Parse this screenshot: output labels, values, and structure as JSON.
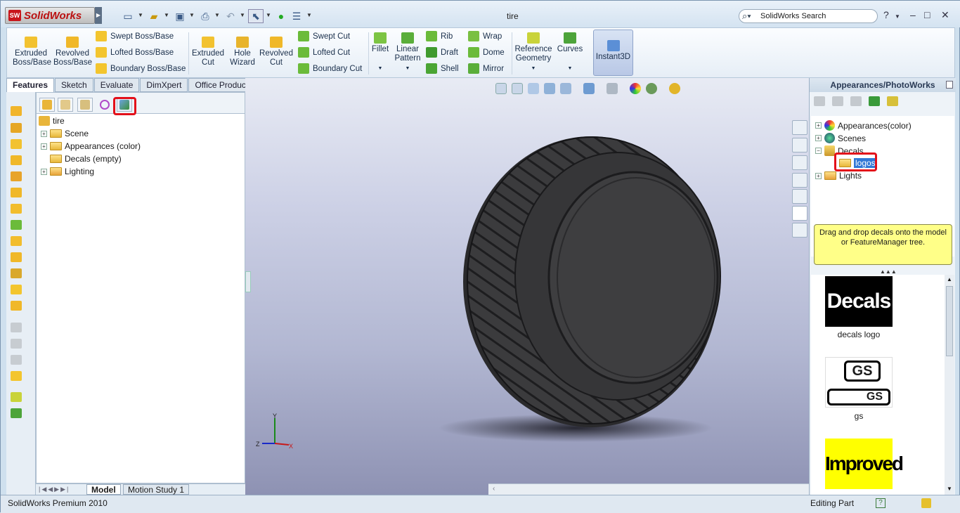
{
  "app": {
    "name": "SolidWorks",
    "doc_title": "tire"
  },
  "search": {
    "placeholder": "SolidWorks Search"
  },
  "window_controls": {
    "help": "?",
    "minimize": "–",
    "maximize": "□",
    "close": "✕"
  },
  "command_manager": {
    "large_buttons": [
      {
        "label": "Extruded\nBoss/Base"
      },
      {
        "label": "Revolved\nBoss/Base"
      },
      {
        "label": "Extruded\nCut"
      },
      {
        "label": "Hole\nWizard"
      },
      {
        "label": "Revolved\nCut"
      },
      {
        "label": "Fillet"
      },
      {
        "label": "Linear\nPattern"
      },
      {
        "label": "Reference\nGeometry"
      },
      {
        "label": "Curves"
      },
      {
        "label": "Instant3D"
      }
    ],
    "small_buttons": [
      "Swept Boss/Base",
      "Lofted Boss/Base",
      "Boundary Boss/Base",
      "Swept Cut",
      "Lofted Cut",
      "Boundary Cut",
      "Rib",
      "Draft",
      "Shell",
      "Wrap",
      "Dome",
      "Mirror"
    ]
  },
  "tabs": [
    "Features",
    "Sketch",
    "Evaluate",
    "DimXpert",
    "Office Products"
  ],
  "feature_tree": {
    "root": "tire",
    "items": [
      "Scene",
      "Appearances (color)",
      "Decals (empty)",
      "Lighting"
    ]
  },
  "bottom_tabs": [
    "Model",
    "Motion Study 1"
  ],
  "task_pane": {
    "title": "Appearances/PhotoWorks",
    "tree": [
      "Appearances(color)",
      "Scenes",
      "Decals",
      "logos",
      "Lights"
    ],
    "tip": "Drag and drop decals onto the model or FeatureManager tree.",
    "decals": [
      {
        "name": "decals logo",
        "image_text": "Decals"
      },
      {
        "name": "gs",
        "image_text": "GS"
      },
      {
        "name": "",
        "image_text": "Improved"
      }
    ]
  },
  "triad": {
    "x": "X",
    "y": "Y",
    "z": "Z"
  },
  "status": {
    "left": "SolidWorks Premium 2010",
    "right": "Editing Part"
  }
}
